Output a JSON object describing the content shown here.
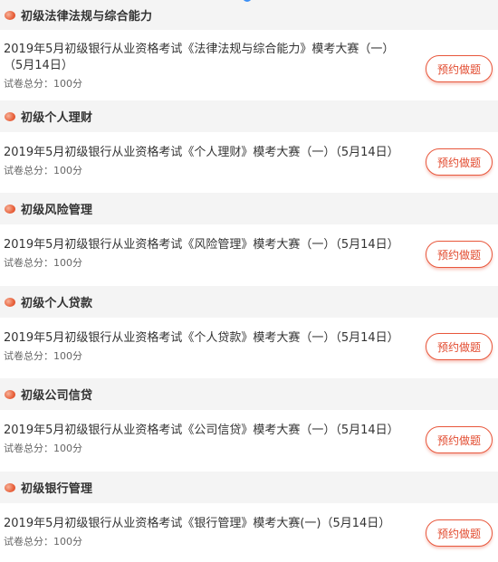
{
  "sections": [
    {
      "title": "初级法律法规与综合能力",
      "exam_title": "2019年5月初级银行从业资格考试《法律法规与综合能力》模考大赛（一）（5月14日）",
      "score": "试卷总分：100分",
      "button": "预约做题"
    },
    {
      "title": "初级个人理财",
      "exam_title": "2019年5月初级银行从业资格考试《个人理财》模考大赛（一）（5月14日）",
      "score": "试卷总分：100分",
      "button": "预约做题"
    },
    {
      "title": "初级风险管理",
      "exam_title": "2019年5月初级银行从业资格考试《风险管理》模考大赛（一）（5月14日）",
      "score": "试卷总分：100分",
      "button": "预约做题"
    },
    {
      "title": "初级个人贷款",
      "exam_title": "2019年5月初级银行从业资格考试《个人贷款》模考大赛（一）（5月14日）",
      "score": "试卷总分：100分",
      "button": "预约做题"
    },
    {
      "title": "初级公司信贷",
      "exam_title": "2019年5月初级银行从业资格考试《公司信贷》模考大赛（一）（5月14日）",
      "score": "试卷总分：100分",
      "button": "预约做题"
    },
    {
      "title": "初级银行管理",
      "exam_title": "2019年5月初级银行从业资格考试《银行管理》模考大赛(一)（5月14日）",
      "score": "试卷总分：100分",
      "button": "预约做题"
    }
  ],
  "colors": {
    "accent": "#e8573c",
    "header_bg": "#f4f4f4"
  }
}
